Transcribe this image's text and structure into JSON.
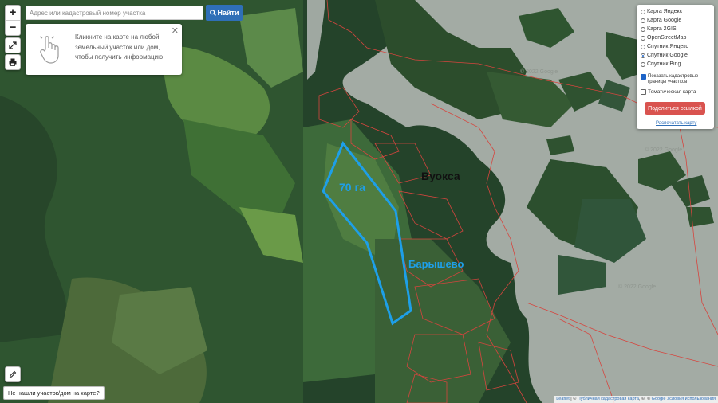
{
  "search": {
    "placeholder": "Адрес или кадастровый номер участка",
    "button_label": "Найти"
  },
  "zoom": {
    "in_label": "+",
    "out_label": "−"
  },
  "hint": {
    "text": "Кликните на карте на любой земельный участок или дом, чтобы получить информацию"
  },
  "layers": {
    "options": [
      "Карта Яндекс",
      "Карта Google",
      "Карта 2GIS",
      "OpenStreetMap",
      "Спутник Яндекс",
      "Спутник Google",
      "Спутник Bing"
    ],
    "selected": "Спутник Google",
    "cadastral_label": "Показать кадастровые границы участков",
    "thematic_label": "Тематическая карта",
    "share_label": "Поделиться ссылкой",
    "print_label": "Распечатать карту"
  },
  "map_labels": {
    "lake": "Вуокса",
    "area": "70 га",
    "village": "Барышево"
  },
  "watermark": "© 2022 Google",
  "not_found_label": "Не нашли участок/дом на карте?",
  "attribution": {
    "leaflet": "Leaflet",
    "cadastral": "Публичная кадастровая карта",
    "google": "Google",
    "terms": "Условия использования"
  },
  "colors": {
    "water": "#a4aca5",
    "forest": "#244a23",
    "field": "#4a7a3a",
    "boundary": "#d6453e",
    "plot_outline": "#1e9fe8"
  }
}
